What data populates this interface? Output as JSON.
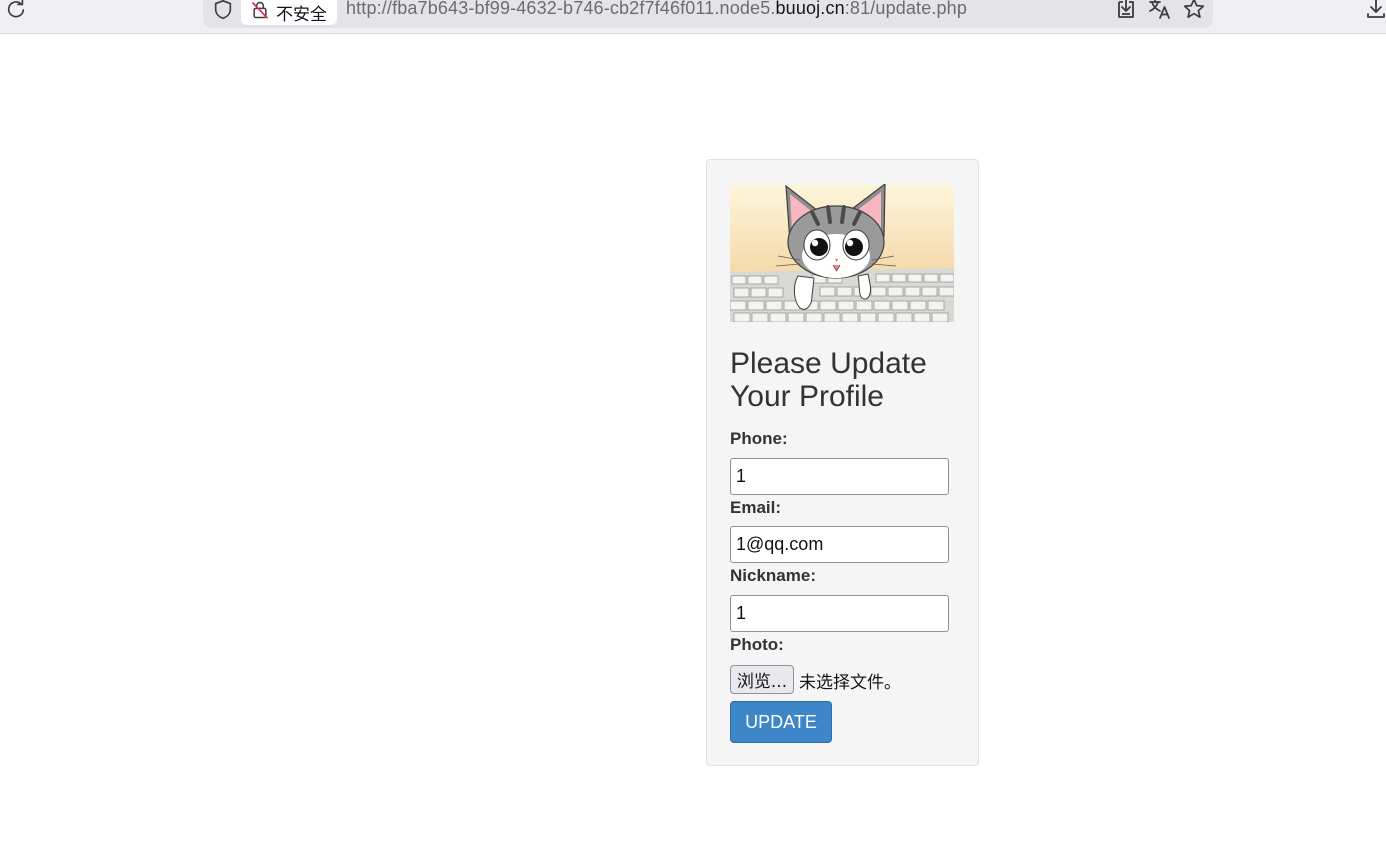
{
  "browser": {
    "security_label": "不安全",
    "url_prefix": "http://fba7b643-bf99-4632-b746-cb2f7f46f011.node5.",
    "url_domain": "buuoj.cn",
    "url_suffix": ":81/update.php",
    "icons": [
      "reload-icon",
      "shield-icon",
      "insecure-lock-icon",
      "save-page-icon",
      "translate-icon",
      "bookmark-star-icon",
      "downloads-icon"
    ]
  },
  "form": {
    "heading": "Please Update Your Profile",
    "phone_label": "Phone:",
    "phone_value": "1",
    "email_label": "Email:",
    "email_value": "1@qq.com",
    "nickname_label": "Nickname:",
    "nickname_value": "1",
    "photo_label": "Photo:",
    "browse_label": "浏览...",
    "no_file_text": "未选择文件。",
    "submit_label": "UPDATE"
  },
  "colors": {
    "accent": "#3d87c9",
    "card_bg": "#f5f5f5",
    "text": "#333333"
  }
}
